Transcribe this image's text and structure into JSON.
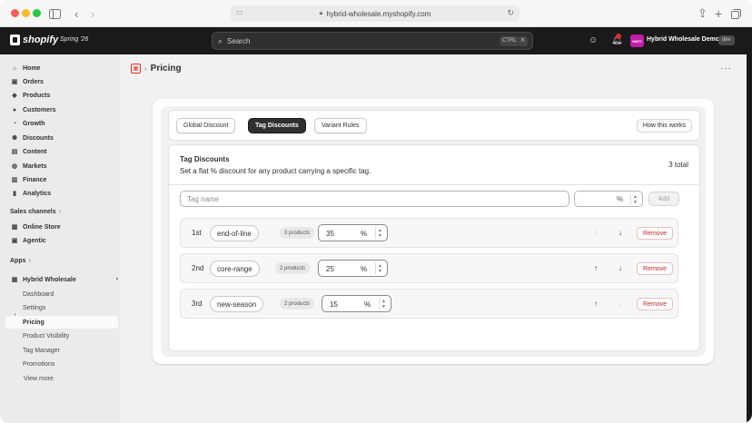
{
  "browser": {
    "url": "hybrid-wholesale.myshopify.com"
  },
  "topbar": {
    "brand": "shopify",
    "edition": "Spring '26",
    "search_placeholder": "Search",
    "shortcut_key1": "CTRL",
    "shortcut_key2": "K",
    "store_initials": "HWTI",
    "store_name": "Hybrid Wholesale Demo",
    "env_badge": "dev"
  },
  "sidebar": {
    "items": [
      {
        "label": "Home",
        "icon": "home-icon"
      },
      {
        "label": "Orders",
        "icon": "orders-icon"
      },
      {
        "label": "Products",
        "icon": "tag-icon"
      },
      {
        "label": "Customers",
        "icon": "person-icon"
      },
      {
        "label": "Growth",
        "icon": "growth-icon"
      },
      {
        "label": "Discounts",
        "icon": "discount-icon"
      },
      {
        "label": "Content",
        "icon": "content-icon"
      },
      {
        "label": "Markets",
        "icon": "globe-icon"
      },
      {
        "label": "Finance",
        "icon": "bank-icon"
      },
      {
        "label": "Analytics",
        "icon": "chart-icon"
      }
    ],
    "sales_channels_label": "Sales channels",
    "channels": [
      {
        "label": "Online Store",
        "icon": "store-icon"
      },
      {
        "label": "Agentic",
        "icon": "agentic-icon"
      }
    ],
    "apps_label": "Apps",
    "app_name": "Hybrid Wholesale",
    "app_subitems": [
      "Dashboard",
      "Settings",
      "Pricing",
      "Product Visibility",
      "Tag Manager",
      "Promotions"
    ],
    "view_more": "View more"
  },
  "page": {
    "title": "Pricing",
    "tabs": [
      "Global Discount",
      "Tag Discounts",
      "Variant Rules"
    ],
    "active_tab": "Tag Discounts",
    "help_button": "How this works",
    "section_title": "Tag Discounts",
    "section_description": "Set a flat % discount for any product carrying a specific tag.",
    "total": "3 total",
    "new_tag_placeholder": "Tag name",
    "pct_symbol": "%",
    "add_button": "Add",
    "remove_label": "Remove",
    "rows": [
      {
        "rank": "1st",
        "tag": "end-of-line",
        "products": "3 products",
        "discount": "35"
      },
      {
        "rank": "2nd",
        "tag": "core-range",
        "products": "2 products",
        "discount": "25"
      },
      {
        "rank": "3rd",
        "tag": "new-season",
        "products": "2 products",
        "discount": "15"
      }
    ]
  }
}
